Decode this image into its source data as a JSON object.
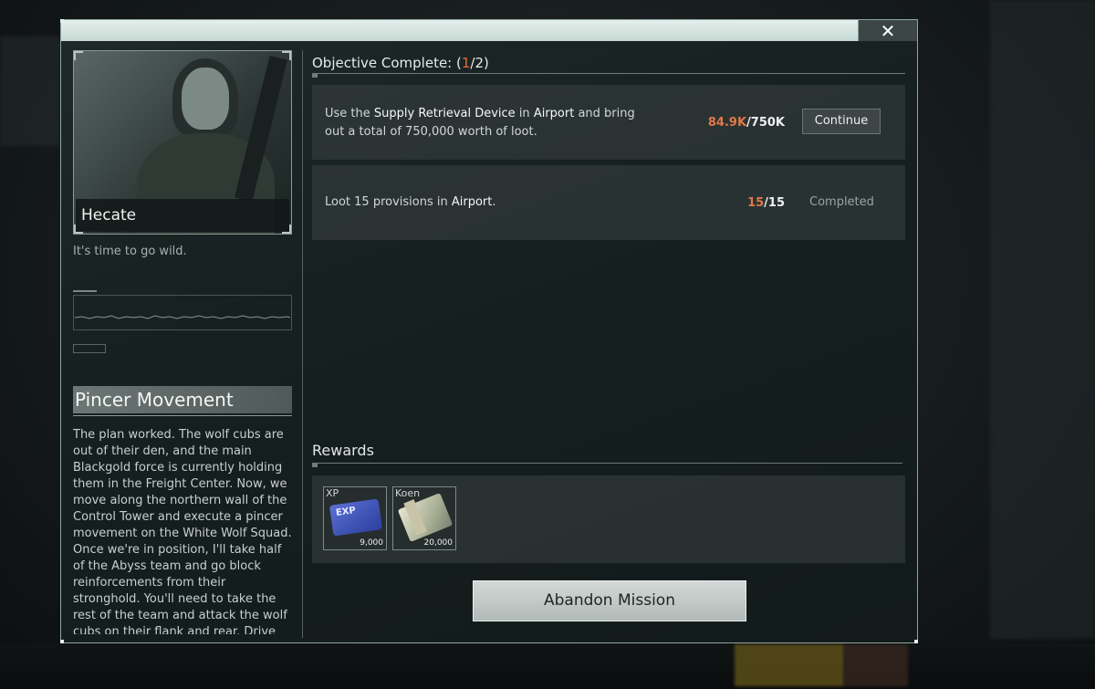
{
  "window": {
    "close_glyph": "✕"
  },
  "character": {
    "name": "Hecate",
    "tagline": "It's time to go wild."
  },
  "mission": {
    "title": "Pincer Movement",
    "description": "The plan worked. The wolf cubs are out of their den, and the main Blackgold force is currently holding them in the Freight Center. Now, we move along the northern wall of the Control Tower and execute a pincer movement on the White Wolf Squad. Once we're in position, I'll take half of the Abyss team and go block reinforcements from their stronghold. You'll need to take the rest of the team and attack the wolf cubs on their flank and rear. Drive"
  },
  "objectives": {
    "header_prefix": "Objective Complete: (",
    "header_done": "1",
    "header_total": "/2)",
    "tasks": [
      {
        "text_1": "Use the ",
        "highlight_1": "Supply Retrieval Device",
        "text_2": " in ",
        "highlight_2": "Airport",
        "text_3": " and bring out a total of 750,000 worth of loot.",
        "progress_current": "84.9K",
        "progress_total": "/750K",
        "action": "Continue"
      },
      {
        "text_1": "Loot 15 provisions in ",
        "highlight_1": "Airport",
        "text_2": ".",
        "progress_current": "15",
        "progress_total": "/15",
        "status": "Completed"
      }
    ]
  },
  "rewards": {
    "heading": "Rewards",
    "items": [
      {
        "label": "XP",
        "amount": "9,000",
        "icon": "exp-card-icon",
        "card_text": "EXP"
      },
      {
        "label": "Koen",
        "amount": "20,000",
        "icon": "cash-stack-icon"
      }
    ]
  },
  "abandon_label": "Abandon Mission",
  "colors": {
    "accent_orange": "#e0784a",
    "titlebar": "#d6e5e0",
    "panel": "#3a4242"
  }
}
